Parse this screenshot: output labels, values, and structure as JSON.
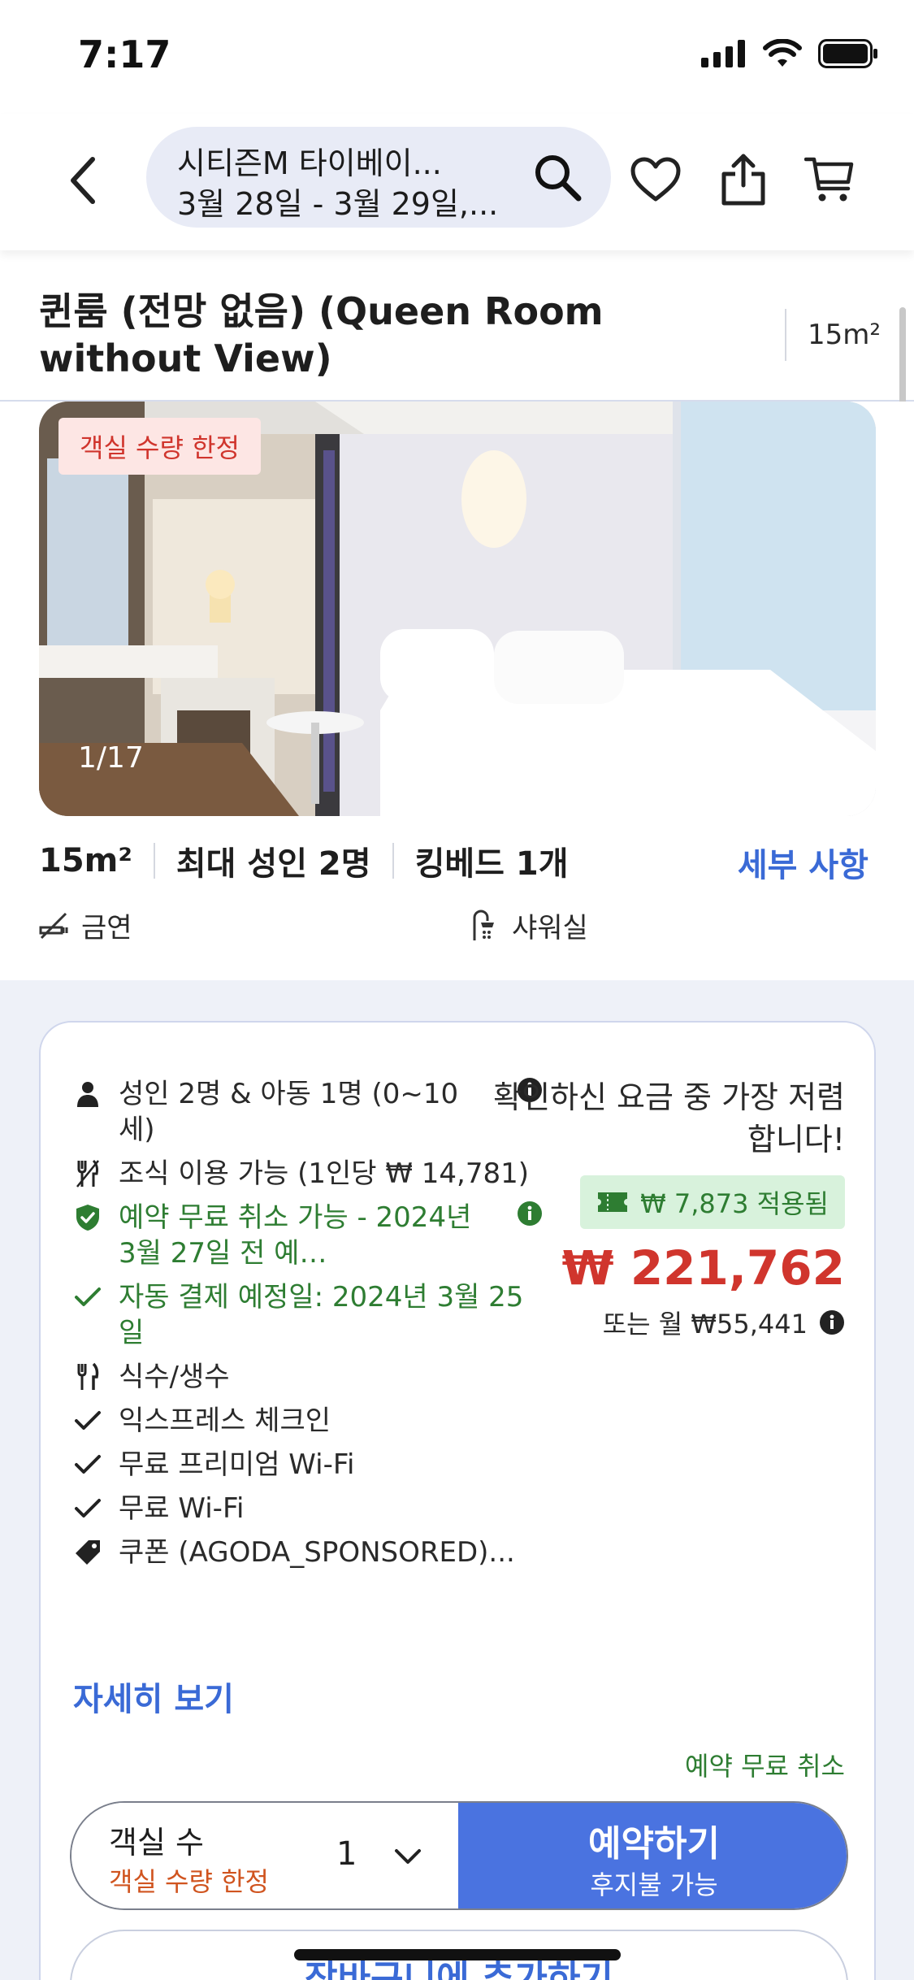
{
  "status_bar": {
    "time": "7:17"
  },
  "header": {
    "hotel_name": "시티즌M 타이베이...",
    "dates": "3월 28일 - 3월 29일,..."
  },
  "room": {
    "title": "퀸룸 (전망 없음) (Queen Room without View)",
    "size": "15m²",
    "limited_badge": "객실 수량 한정",
    "photo_counter": "1/17",
    "specs": [
      "15m²",
      "최대 성인 2명",
      "킹베드 1개"
    ],
    "details_link": "세부 사항",
    "amenities": [
      {
        "icon": "no-smoking-icon",
        "label": "금연"
      },
      {
        "icon": "shower-icon",
        "label": "샤워실"
      }
    ]
  },
  "offer": {
    "features": [
      {
        "icon": "person-icon",
        "text": "성인 2명 & 아동 1명 (0~10세)",
        "color": "default",
        "info": true
      },
      {
        "icon": "cutlery-icon",
        "text": "조식 이용 가능 (1인당 ₩ 14,781)",
        "color": "default",
        "info": false
      },
      {
        "icon": "shield-check-icon",
        "text": "예약 무료 취소 가능 - 2024년 3월 27일 전 예…",
        "color": "green",
        "info": true
      },
      {
        "icon": "check-icon",
        "text": "자동 결제 예정일: 2024년 3월 25일",
        "color": "green",
        "info": false
      },
      {
        "icon": "cutlery-icon",
        "text": "식수/생수",
        "color": "default",
        "info": false
      },
      {
        "icon": "check-icon",
        "text": "익스프레스 체크인",
        "color": "default",
        "info": false
      },
      {
        "icon": "check-icon",
        "text": "무료 프리미엄 Wi-Fi",
        "color": "default",
        "info": false
      },
      {
        "icon": "check-icon",
        "text": "무료 Wi-Fi",
        "color": "default",
        "info": false
      },
      {
        "icon": "tag-icon",
        "text": "쿠폰 (AGODA_SPONSORED)...",
        "color": "default",
        "info": false
      }
    ],
    "more_link": "자세히 보기",
    "best_rate": "확인하신 요금 중 가장 저렴합니다!",
    "coupon_applied": "₩ 7,873 적용됨",
    "price": "₩ 221,762",
    "monthly": "또는 월 ₩55,441",
    "free_cancel": "예약 무료 취소",
    "room_count_label": "객실 수",
    "room_count_sub": "객실 수량 한정",
    "room_qty": "1",
    "reserve_label": "예약하기",
    "reserve_sub": "후지불 가능",
    "cart_label": "장바구니에 추가하기"
  },
  "colors": {
    "accent_blue": "#3a6ad6",
    "price_red": "#d0352d",
    "green": "#2e7d32",
    "button_blue": "#4a73e0"
  }
}
